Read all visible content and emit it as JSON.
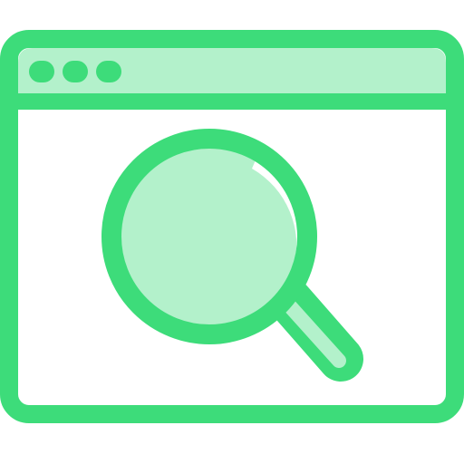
{
  "icon": {
    "name": "browser-search-icon",
    "parts": [
      "browser-window-icon",
      "window-dot-icon",
      "magnifying-glass-icon"
    ]
  },
  "colors": {
    "stroke": "#3ddc7a",
    "fill_light": "#b3f1cb",
    "background": "#ffffff"
  }
}
